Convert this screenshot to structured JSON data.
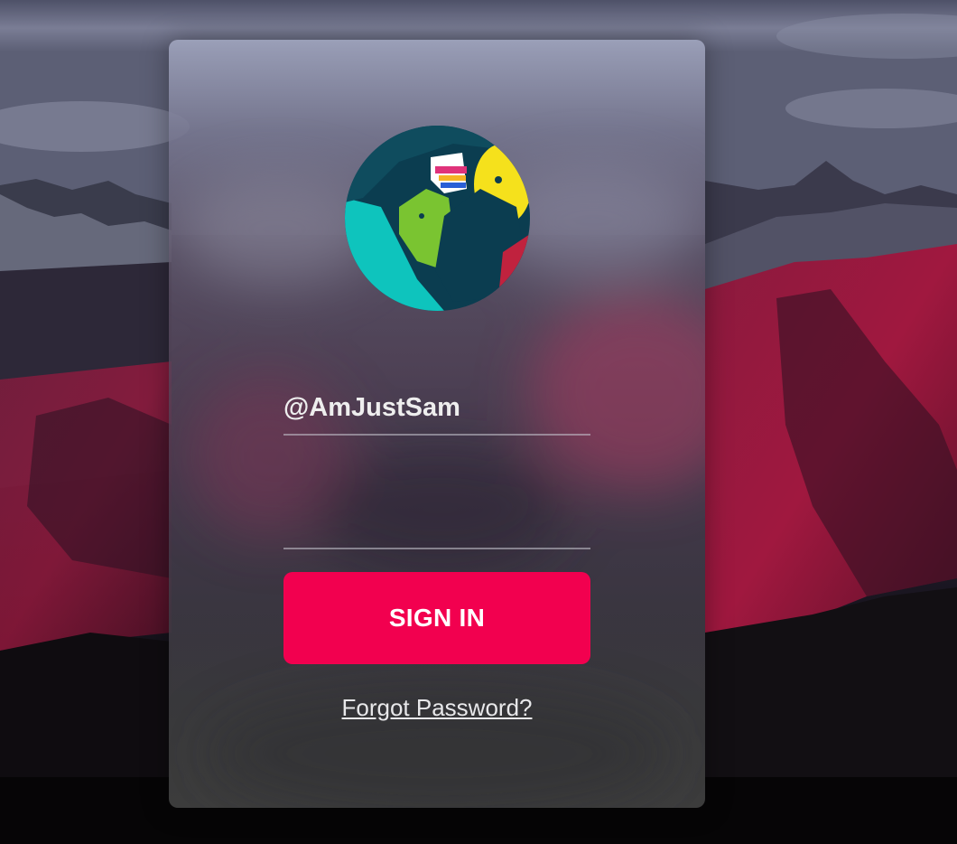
{
  "login": {
    "avatar_icon": "user-avatar-illustration",
    "username_value": "@AmJustSam",
    "password_value": "",
    "signin_label": "SIGN IN",
    "forgot_label": "Forgot Password?"
  },
  "colors": {
    "accent": "#f2004f",
    "field_text": "#eeeeee",
    "underline": "#c8c8d2"
  }
}
